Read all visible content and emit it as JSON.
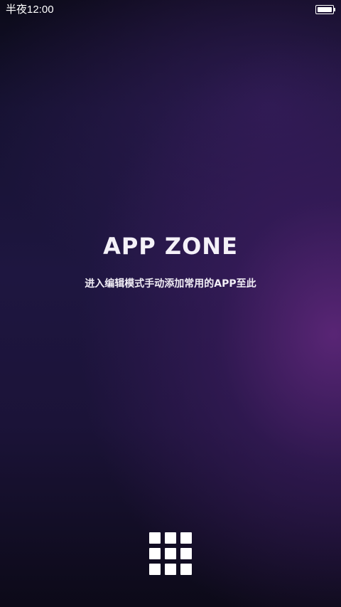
{
  "status_bar": {
    "time": "半夜12:00",
    "battery_level": 1.0
  },
  "main": {
    "title": "APP ZONE",
    "hint": "进入编辑模式手动添加常用的APP至此"
  },
  "footer": {
    "app_drawer_icon": "grid-3x3-icon"
  },
  "colors": {
    "background_dark": "#0d0a1a",
    "background_purple": "#5c2678",
    "text": "#ffffff"
  }
}
